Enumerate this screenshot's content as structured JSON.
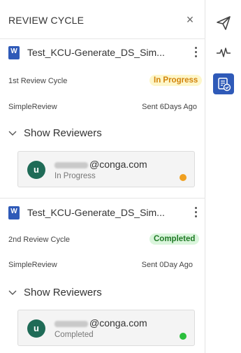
{
  "panel": {
    "title": "REVIEW CYCLE",
    "close_glyph": "×"
  },
  "cards": [
    {
      "doc_icon_letter": "W",
      "doc_name": "Test_KCU-Generate_DS_Sim...",
      "cycle_label": "1st Review Cycle",
      "status": "In Progress",
      "review_type": "SimpleReview",
      "sent": "Sent 6Days Ago",
      "show_reviewers": "Show Reviewers",
      "reviewer": {
        "avatar_letter": "u",
        "email_domain": "@conga.com",
        "status": "In Progress",
        "status_color": "#f0a020"
      }
    },
    {
      "doc_icon_letter": "W",
      "doc_name": "Test_KCU-Generate_DS_Sim...",
      "cycle_label": "2nd Review Cycle",
      "status": "Completed",
      "review_type": "SimpleReview",
      "sent": "Sent 0Day Ago",
      "show_reviewers": "Show Reviewers",
      "reviewer": {
        "avatar_letter": "u",
        "email_domain": "@conga.com",
        "status": "Completed",
        "status_color": "#2bbf3c"
      }
    }
  ],
  "rail": {
    "items": [
      {
        "icon": "send-icon",
        "active": false
      },
      {
        "icon": "activity-icon",
        "active": false
      },
      {
        "icon": "review-check-icon",
        "active": true
      }
    ]
  },
  "colors": {
    "accent": "#2f5ab8",
    "avatar": "#1f6b57",
    "in_progress": "#d3840b",
    "completed": "#1f7a25"
  }
}
